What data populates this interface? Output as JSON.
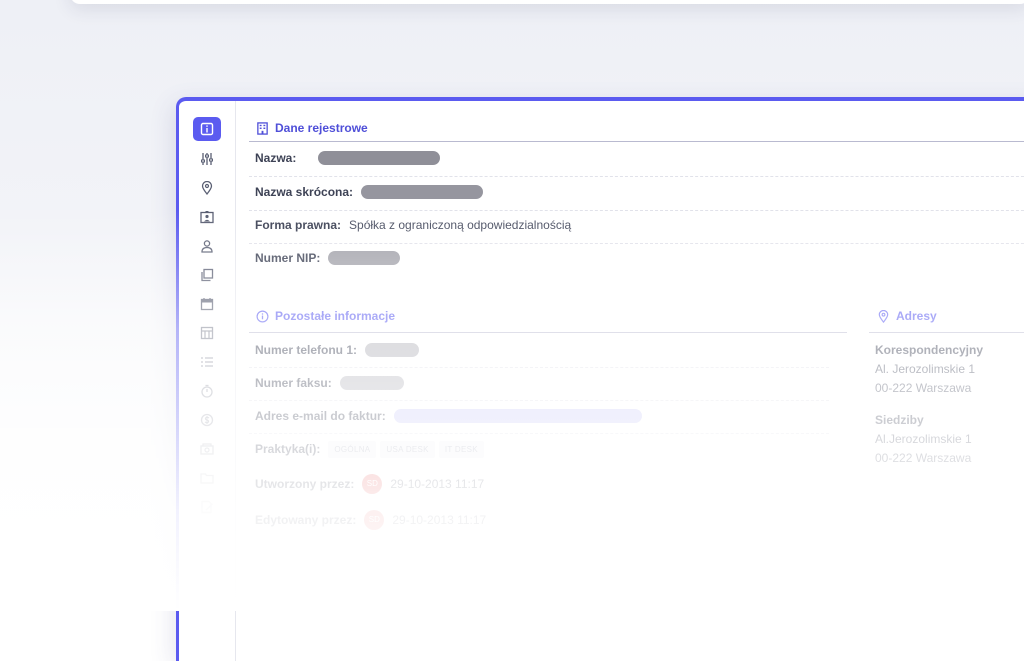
{
  "sidebar": {
    "items": [
      {
        "icon": "info-icon",
        "active": true
      },
      {
        "icon": "sliders-icon"
      },
      {
        "icon": "location-pin-icon"
      },
      {
        "icon": "id-card-icon"
      },
      {
        "icon": "user-icon"
      },
      {
        "icon": "copy-icon"
      },
      {
        "icon": "calendar-icon"
      },
      {
        "icon": "invoice-icon"
      },
      {
        "icon": "checklist-icon"
      },
      {
        "icon": "stopwatch-icon"
      },
      {
        "icon": "dollar-icon"
      },
      {
        "icon": "money-icon"
      },
      {
        "icon": "folder-icon"
      },
      {
        "icon": "edit-document-icon"
      }
    ]
  },
  "registry": {
    "title": "Dane rejestrowe",
    "rows": [
      {
        "label": "Nazwa:",
        "value": ""
      },
      {
        "label": "Nazwa skrócona:",
        "value": ""
      },
      {
        "label": "Forma prawna:",
        "value": "Spółka z ograniczoną odpowiedzialnością"
      },
      {
        "label": "Numer NIP:",
        "value": ""
      }
    ]
  },
  "other": {
    "title": "Pozostałe informacje",
    "rows": [
      {
        "label": "Numer telefonu 1:"
      },
      {
        "label": "Numer faksu:"
      },
      {
        "label": "Adres e-mail do faktur:"
      },
      {
        "label": "Praktyka(i):"
      },
      {
        "label": "Utworzony przez:",
        "avatar": "SD",
        "date": "29-10-2013 11:17"
      },
      {
        "label": "Edytowany przez:",
        "avatar": "SD",
        "date": "29-10-2013 11:17"
      }
    ],
    "practices": [
      "OGÓLNA",
      "USA DESK",
      "IT DESK"
    ]
  },
  "addresses": {
    "title": "Adresy",
    "correspondence": {
      "title": "Korespondencyjny",
      "line1": "Al. Jerozolimskie 1",
      "line2": "00-222 Warszawa"
    },
    "seat": {
      "title": "Siedziby",
      "line1": "Al.Jerozolimskie 1",
      "line2": "00-222 Warszawa"
    }
  },
  "colors": {
    "accent": "#5b5bf0",
    "email_pill": "#c9c9f7",
    "avatar": "#e24a4a"
  }
}
